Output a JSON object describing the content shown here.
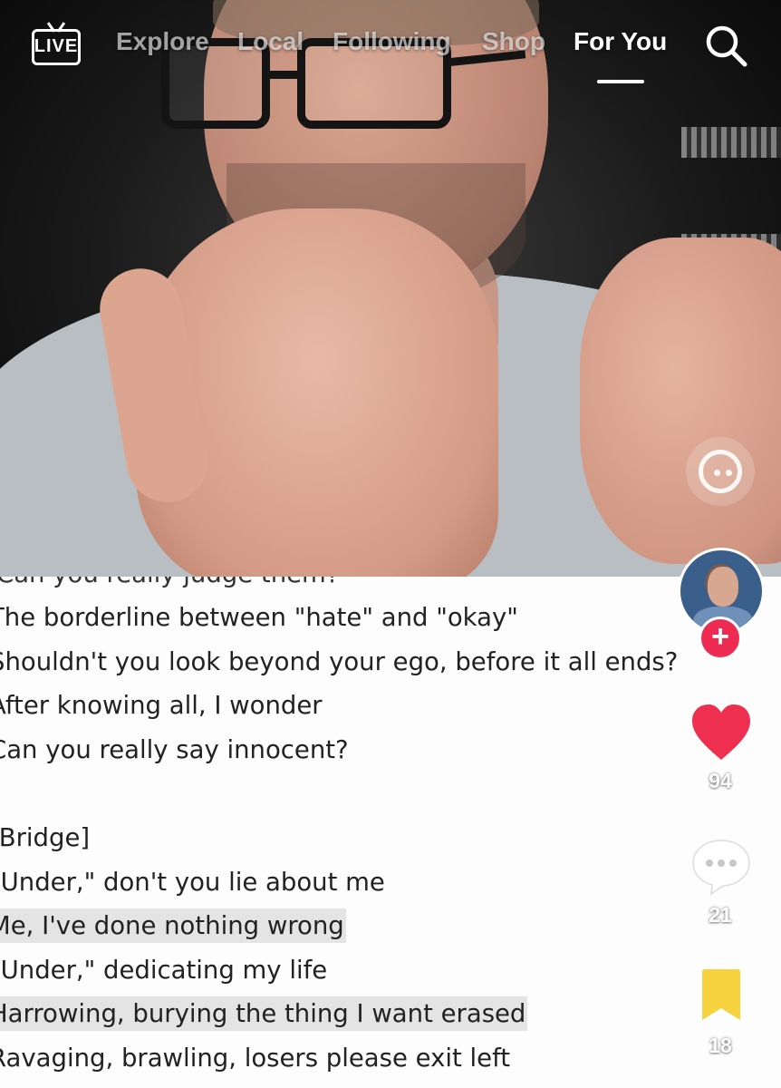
{
  "nav": {
    "live_label": "LIVE",
    "tabs": [
      {
        "label": "Explore"
      },
      {
        "label": "Local"
      },
      {
        "label": "Following"
      },
      {
        "label": "Shop"
      },
      {
        "label": "For You"
      }
    ],
    "active_tab": "For You"
  },
  "lyrics": {
    "cut_line": "Can you really judge them?",
    "lines": [
      {
        "text": "The borderline between \"hate\" and \"okay\"",
        "highlighted": false
      },
      {
        "text": "Shouldn't you look beyond your ego, before it all ends?",
        "highlighted": false
      },
      {
        "text": "After knowing all, I wonder",
        "highlighted": false
      },
      {
        "text": "Can you really say innocent?",
        "highlighted": false
      },
      {
        "text": "",
        "highlighted": false
      },
      {
        "text": "[Bridge]",
        "highlighted": false
      },
      {
        "text": "\"Under,\" don't you lie about me",
        "highlighted": false
      },
      {
        "text": "Me, I've done nothing wrong",
        "highlighted": true
      },
      {
        "text": "\"Under,\" dedicating my life",
        "highlighted": false
      },
      {
        "text": "Harrowing, burying the thing I want erased",
        "highlighted": true
      },
      {
        "text": "Ravaging, brawling, losers please exit left",
        "highlighted": false
      }
    ]
  },
  "actions": {
    "likes": "94",
    "comments": "21",
    "saves": "18"
  },
  "icons": {
    "live": "live-icon",
    "search": "search-icon",
    "chat_bubble": "chat-bubble-icon",
    "follow": "plus-icon",
    "like": "heart-icon",
    "comment": "comment-icon",
    "save": "bookmark-icon"
  },
  "colors": {
    "like": "#EE2F4F",
    "follow": "#EE2C53",
    "bookmark": "#F7D23F",
    "highlight": "#E4E4E4"
  }
}
